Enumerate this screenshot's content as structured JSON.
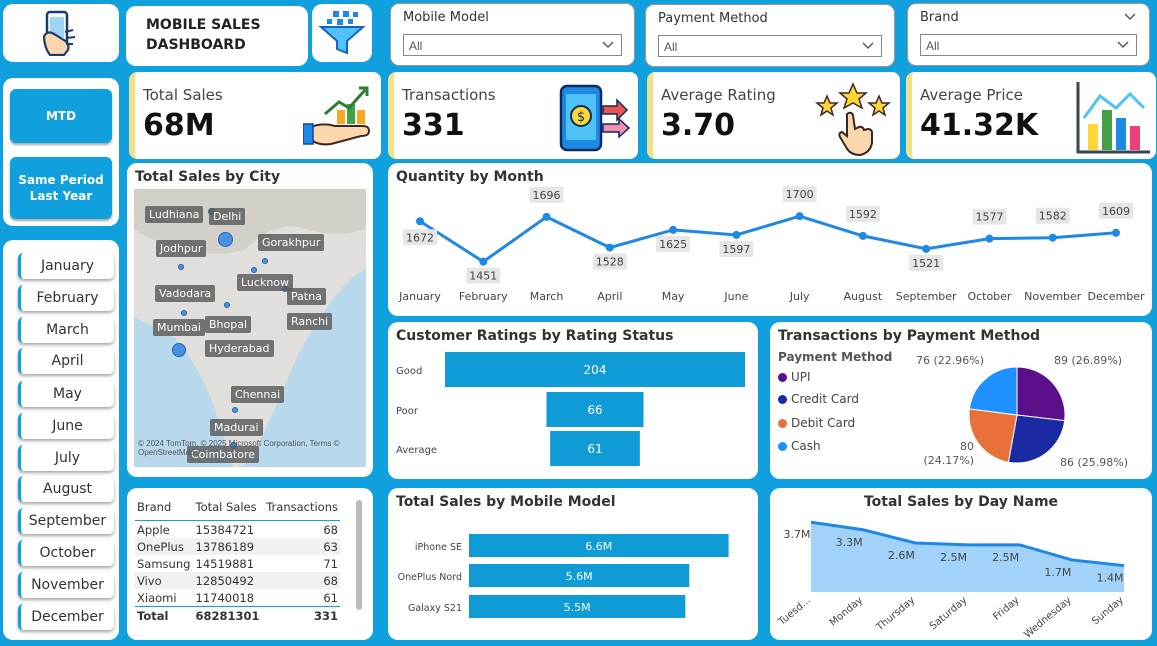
{
  "header": {
    "title": "MOBILE SALES DASHBOARD",
    "logo_icon": "phone-hand-icon",
    "filter_icon": "funnel-icon"
  },
  "slicers": {
    "model": {
      "label": "Mobile Model",
      "value": "All"
    },
    "payment": {
      "label": "Payment Method",
      "value": "All"
    },
    "brand": {
      "label": "Brand",
      "value": "All"
    }
  },
  "period": {
    "mtd": "MTD",
    "spy": "Same Period Last Year"
  },
  "months": [
    "January",
    "February",
    "March",
    "April",
    "May",
    "June",
    "July",
    "August",
    "September",
    "October",
    "November",
    "December"
  ],
  "kpis": {
    "sales": {
      "label": "Total Sales",
      "value": "68M"
    },
    "transactions": {
      "label": "Transactions",
      "value": "331"
    },
    "rating": {
      "label": "Average Rating",
      "value": "3.70"
    },
    "price": {
      "label": "Average Price",
      "value": "41.32K"
    }
  },
  "map": {
    "title": "Total Sales by City",
    "cities": [
      "Ludhiana",
      "Delhi",
      "Jodhpur",
      "Gorakhpur",
      "Lucknow",
      "Vadodara",
      "Patna",
      "Mumbai",
      "Bhopal",
      "Ranchi",
      "Hyderabad",
      "Chennai",
      "Madurai",
      "Coimbatore"
    ],
    "attribution": "© 2024 TomTom, © 2025 Microsoft Corporation, Terms © OpenStreetMap"
  },
  "table": {
    "headers": [
      "Brand",
      "Total Sales",
      "Transactions"
    ],
    "rows": [
      [
        "Apple",
        "15384721",
        "68"
      ],
      [
        "OnePlus",
        "13786189",
        "63"
      ],
      [
        "Samsung",
        "14519881",
        "71"
      ],
      [
        "Vivo",
        "12850492",
        "68"
      ],
      [
        "Xiaomi",
        "11740018",
        "61"
      ]
    ],
    "total": [
      "Total",
      "68281301",
      "331"
    ]
  },
  "colors": {
    "background": "#10a0de",
    "accent_line": "#1e88e5",
    "bar": "#0f9bd6",
    "kpi_border": "#f3e08a"
  },
  "chart_data": [
    {
      "type": "line",
      "title": "Quantity by Month",
      "x": [
        "January",
        "February",
        "March",
        "April",
        "May",
        "June",
        "July",
        "August",
        "September",
        "October",
        "November",
        "December"
      ],
      "values": [
        1672,
        1451,
        1696,
        1528,
        1625,
        1597,
        1700,
        1592,
        1521,
        1577,
        1582,
        1609
      ],
      "ylim": [
        1400,
        1750
      ],
      "grid": false
    },
    {
      "type": "bar",
      "orientation": "horizontal",
      "title": "Customer Ratings by Rating Status",
      "categories": [
        "Good",
        "Poor",
        "Average"
      ],
      "values": [
        204,
        66,
        61
      ],
      "labels": [
        "204",
        "66",
        "61"
      ]
    },
    {
      "type": "pie",
      "title": "Transactions by Payment Method",
      "legend_title": "Payment Method",
      "categories": [
        "UPI",
        "Credit Card",
        "Debit Card",
        "Cash"
      ],
      "values": [
        89,
        86,
        80,
        76
      ],
      "labels": [
        "89 (26.89%)",
        "86 (25.98%)",
        "80 (24.17%)",
        "76 (22.96%)"
      ],
      "colors": [
        "#5b0f8b",
        "#1b2aa3",
        "#e8703a",
        "#1e90ff"
      ],
      "legend_placement": "left"
    },
    {
      "type": "bar",
      "orientation": "horizontal",
      "title": "Total Sales by Mobile Model",
      "categories": [
        "iPhone SE",
        "OnePlus Nord",
        "Galaxy S21"
      ],
      "values": [
        6.6,
        5.6,
        5.5
      ],
      "labels": [
        "6.6M",
        "5.6M",
        "5.5M"
      ],
      "xlim": [
        0,
        7.5
      ]
    },
    {
      "type": "area",
      "title": "Total Sales by Day Name",
      "x": [
        "Tuesd...",
        "Monday",
        "Thursday",
        "Saturday",
        "Friday",
        "Wednesday",
        "Sunday"
      ],
      "values": [
        3.7,
        3.3,
        2.6,
        2.5,
        2.5,
        1.7,
        1.4
      ],
      "labels": [
        "3.7M",
        "3.3M",
        "2.6M",
        "2.5M",
        "2.5M",
        "1.7M",
        "1.4M"
      ],
      "ylim": [
        0,
        4.2
      ]
    }
  ]
}
